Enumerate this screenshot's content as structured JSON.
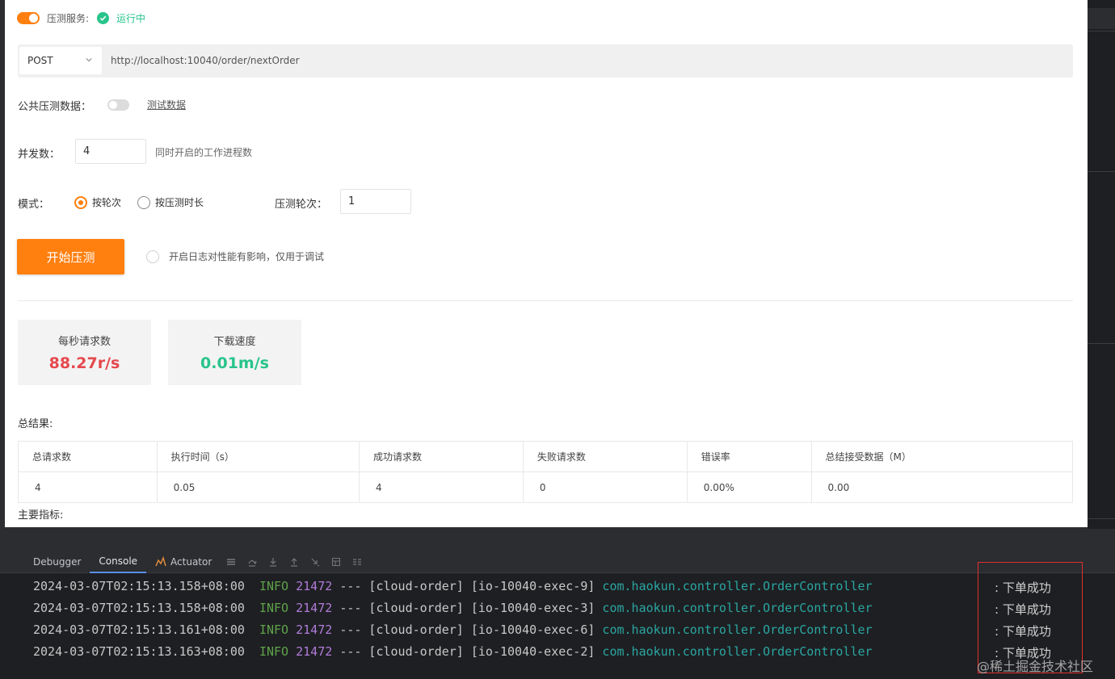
{
  "service": {
    "label": "压测服务:",
    "status": "运行中"
  },
  "request": {
    "method": "POST",
    "url": "http://localhost:10040/order/nextOrder"
  },
  "public_data": {
    "label": "公共压测数据：",
    "link": "测试数据"
  },
  "concurrency": {
    "label": "并发数：",
    "value": "4",
    "hint": "同时开启的工作进程数"
  },
  "mode": {
    "label": "模式：",
    "options": [
      "按轮次",
      "按压测时长"
    ],
    "rounds_label": "压测轮次：",
    "rounds_value": "1"
  },
  "actions": {
    "start": "开始压测",
    "log_hint": "开启日志对性能有影响，仅用于调试"
  },
  "stats": {
    "rps_label": "每秒请求数",
    "rps_value": "88.27r/s",
    "dl_label": "下载速度",
    "dl_value": "0.01m/s"
  },
  "results": {
    "title": "总结果:",
    "headers": [
      "总请求数",
      "执行时间（s）",
      "成功请求数",
      "失败请求数",
      "错误率",
      "总结接受数据（M）"
    ],
    "row": [
      "4",
      "0.05",
      "4",
      "0",
      "0.00%",
      "0.00"
    ]
  },
  "metrics_title": "主要指标:",
  "console": {
    "tabs": [
      "Debugger",
      "Console",
      "Actuator"
    ],
    "lines": [
      {
        "ts": "2024-03-07T02:15:13.158+08:00",
        "level": "INFO",
        "pid": "21472",
        "thread": "--- [cloud-order] [io-10040-exec-9]",
        "cls": "com.haokun.controller.OrderController",
        "msg": ": 下单成功"
      },
      {
        "ts": "2024-03-07T02:15:13.158+08:00",
        "level": "INFO",
        "pid": "21472",
        "thread": "--- [cloud-order] [io-10040-exec-3]",
        "cls": "com.haokun.controller.OrderController",
        "msg": ": 下单成功"
      },
      {
        "ts": "2024-03-07T02:15:13.161+08:00",
        "level": "INFO",
        "pid": "21472",
        "thread": "--- [cloud-order] [io-10040-exec-6]",
        "cls": "com.haokun.controller.OrderController",
        "msg": ": 下单成功"
      },
      {
        "ts": "2024-03-07T02:15:13.163+08:00",
        "level": "INFO",
        "pid": "21472",
        "thread": "--- [cloud-order] [io-10040-exec-2]",
        "cls": "com.haokun.controller.OrderController",
        "msg": ": 下单成功"
      }
    ]
  },
  "watermark": "@稀土掘金技术社区",
  "colors": {
    "accent": "#ff7f0f",
    "success": "#27c48b",
    "danger": "#e5484d"
  }
}
